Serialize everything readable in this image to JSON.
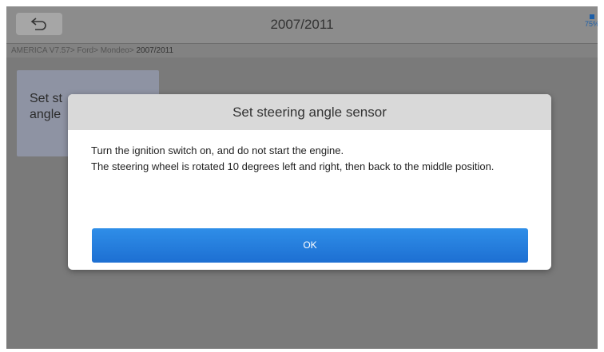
{
  "header": {
    "title": "2007/2011",
    "corner_label": "75%"
  },
  "breadcrumb": {
    "path": "AMERICA V7.57> Ford> Mondeo>",
    "current": " 2007/2011"
  },
  "tile": {
    "label_line1": "Set st",
    "label_line2": "angle"
  },
  "dialog": {
    "title": "Set steering angle sensor",
    "line1": "Turn the ignition switch on, and do not start the engine.",
    "line2": "The steering wheel is rotated 10 degrees left and right, then back to the middle position.",
    "ok_label": "OK"
  },
  "colors": {
    "accent": "#1d6fd2",
    "overlay": "#7a7a7a"
  },
  "icons": {
    "back": "back-arrow-icon"
  }
}
